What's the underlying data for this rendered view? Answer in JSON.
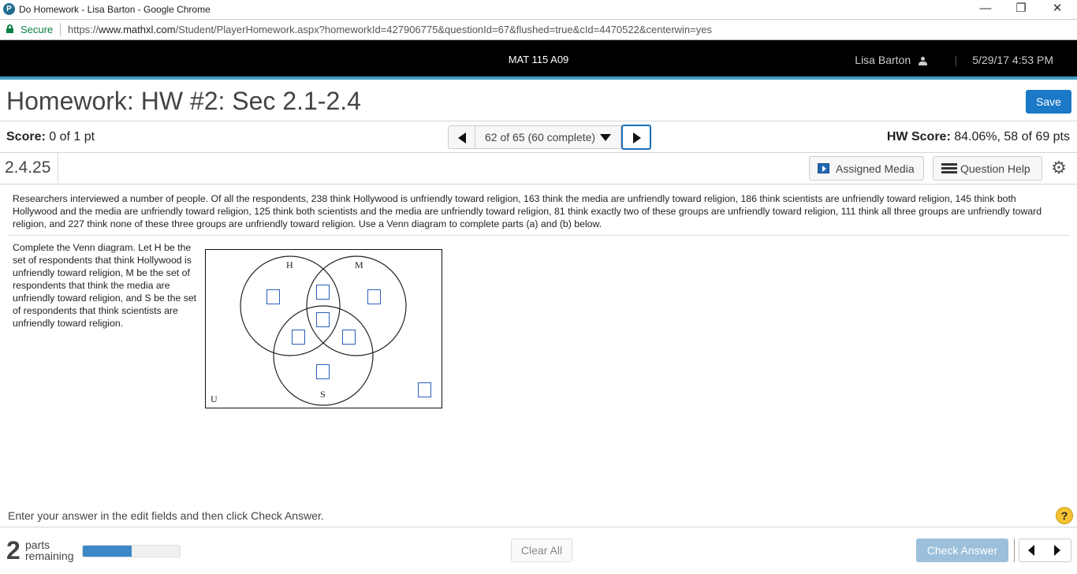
{
  "browser": {
    "window_title": "Do Homework - Lisa Barton - Google Chrome",
    "secure_label": "Secure",
    "url_scheme": "https://",
    "url_host": "www.mathxl.com",
    "url_path": "/Student/PlayerHomework.aspx?homeworkId=427906775&questionId=67&flushed=true&cId=4470522&centerwin=yes",
    "controls": {
      "minimize": "—",
      "restore": "❐",
      "close": "✕"
    }
  },
  "header": {
    "course": "MAT 115 A09",
    "user_name": "Lisa Barton",
    "separator": "|",
    "datetime": "5/29/17 4:53 PM"
  },
  "homework": {
    "title": "Homework: HW #2: Sec 2.1-2.4",
    "save_label": "Save",
    "score_label": "Score:",
    "score_value": " 0 of 1 pt",
    "question_selector": "62 of 65 (60 complete)",
    "hw_score_label": "HW Score:",
    "hw_score_value": " 84.06%, 58 of 69 pts",
    "question_number": "2.4.25",
    "assigned_media_label": "Assigned Media",
    "question_help_label": "Question Help"
  },
  "problem": {
    "text": "Researchers interviewed a number of people. Of all the respondents, 238 think Hollywood is unfriendly toward religion, 163 think the media are unfriendly toward religion, 186 think scientists are unfriendly toward religion, 145 think both Hollywood and the media are unfriendly toward religion, 125 think both scientists and the media are unfriendly toward religion, 81 think exactly two of these groups are unfriendly toward religion, 111 think all three groups are unfriendly toward religion, and 227 think none of these three groups are unfriendly toward religion. Use a Venn diagram to complete parts (a) and (b) below.",
    "instruction": "Complete the Venn diagram. Let H be the set of respondents that think Hollywood is unfriendly toward religion, M be the set of respondents that think the media are unfriendly toward religion, and S be the set of respondents that think scientists are unfriendly toward religion."
  },
  "venn": {
    "labels": {
      "H": "H",
      "M": "M",
      "S": "S",
      "U": "U"
    },
    "inputs": {
      "H_only": "",
      "H_M_only": "",
      "M_only": "",
      "H_M_S": "",
      "H_S_only": "",
      "M_S_only": "",
      "S_only": "",
      "none": ""
    }
  },
  "footer": {
    "message": "Enter your answer in the edit fields and then click Check Answer.",
    "help_glyph": "?",
    "parts_remaining_count": "2",
    "parts_word": "parts",
    "remaining_word": "remaining",
    "progress_fraction": 0.5,
    "clear_all_label": "Clear All",
    "check_answer_label": "Check Answer"
  }
}
